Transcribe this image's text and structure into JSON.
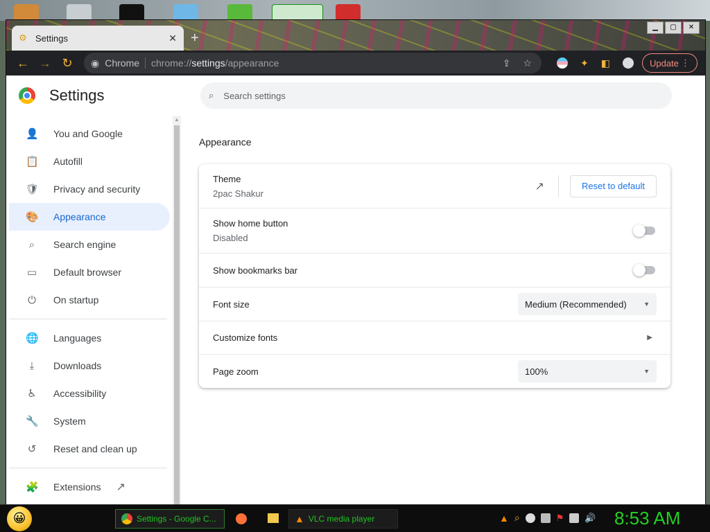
{
  "browser": {
    "tab_title": "Settings",
    "tab_close": "✕",
    "new_tab": "+",
    "window_controls": [
      "▁",
      "▢",
      "✕"
    ],
    "site_label": "Chrome",
    "url_prefix": "chrome://",
    "url_host": "settings",
    "url_path": "/appearance",
    "update_label": "Update",
    "update_menu": "⋮"
  },
  "page": {
    "title": "Settings",
    "search_placeholder": "Search settings"
  },
  "sidebar": {
    "items": [
      {
        "label": "You and Google",
        "icon": "person-icon",
        "glyph": "👤"
      },
      {
        "label": "Autofill",
        "icon": "clipboard-icon",
        "glyph": "📋"
      },
      {
        "label": "Privacy and security",
        "icon": "shield-icon",
        "glyph": "🛡"
      },
      {
        "label": "Appearance",
        "icon": "palette-icon",
        "glyph": "🎨",
        "active": true
      },
      {
        "label": "Search engine",
        "icon": "search-icon",
        "glyph": "⌕"
      },
      {
        "label": "Default browser",
        "icon": "browser-icon",
        "glyph": "▭"
      },
      {
        "label": "On startup",
        "icon": "power-icon",
        "glyph": "⏻"
      }
    ],
    "items2": [
      {
        "label": "Languages",
        "icon": "globe-icon",
        "glyph": "🌐"
      },
      {
        "label": "Downloads",
        "icon": "download-icon",
        "glyph": "⤓"
      },
      {
        "label": "Accessibility",
        "icon": "accessibility-icon",
        "glyph": "♿"
      },
      {
        "label": "System",
        "icon": "wrench-icon",
        "glyph": "🔧"
      },
      {
        "label": "Reset and clean up",
        "icon": "history-icon",
        "glyph": "↺"
      }
    ],
    "extensions": {
      "label": "Extensions",
      "icon": "puzzle-icon",
      "glyph": "🧩",
      "link_glyph": "↗"
    }
  },
  "appearance": {
    "section_title": "Appearance",
    "theme": {
      "label": "Theme",
      "value": "2pac Shakur",
      "reset_label": "Reset to default",
      "link_glyph": "↗"
    },
    "home_button": {
      "label": "Show home button",
      "value": "Disabled",
      "enabled": false
    },
    "bookmarks_bar": {
      "label": "Show bookmarks bar",
      "enabled": false
    },
    "font_size": {
      "label": "Font size",
      "value": "Medium (Recommended)",
      "arrow": "▼"
    },
    "customize_fonts": {
      "label": "Customize fonts",
      "chevron": "▶"
    },
    "page_zoom": {
      "label": "Page zoom",
      "value": "100%",
      "arrow": "▼"
    }
  },
  "taskbar": {
    "tasks": [
      {
        "label": "Settings - Google C...",
        "icon": "chrome-icon"
      },
      {
        "label": "VLC media player",
        "icon": "vlc-icon"
      }
    ],
    "clock": "8:53 AM",
    "start_glyph": "😀"
  },
  "colors": {
    "accent": "#1a73e8",
    "active_bg": "#e8f0fe",
    "update": "#f28b82",
    "taskbar_text": "#21c521"
  }
}
